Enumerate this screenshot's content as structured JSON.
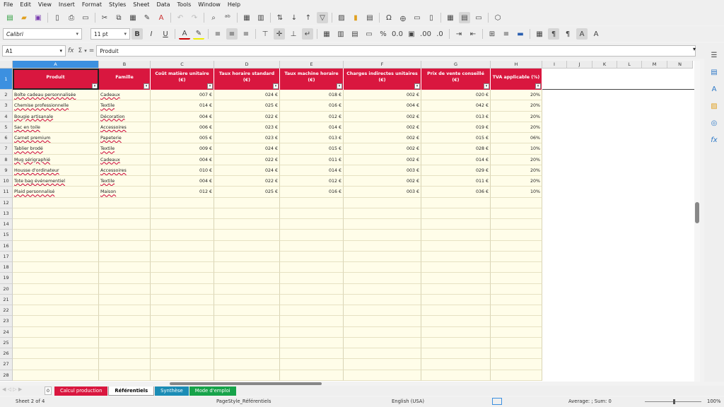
{
  "menu": [
    "File",
    "Edit",
    "View",
    "Insert",
    "Format",
    "Styles",
    "Sheet",
    "Data",
    "Tools",
    "Window",
    "Help"
  ],
  "toolbar": {
    "font_name": "Calibri",
    "font_size": "11 pt"
  },
  "formula_bar": {
    "cell_ref": "A1",
    "content": "Produit",
    "sum_symbol": "Σ",
    "equals": "="
  },
  "columns": [
    "A",
    "B",
    "C",
    "D",
    "E",
    "F",
    "G",
    "H",
    "I",
    "J",
    "K",
    "L",
    "M",
    "N"
  ],
  "header_row": [
    "Produit",
    "Famille",
    "Coût matière unitaire (€)",
    "Taux horaire standard (€)",
    "Taux machine horaire (€)",
    "Charges indirectes unitaires (€)",
    "Prix de vente conseillé (€)",
    "TVA applicable (%)"
  ],
  "rows": [
    [
      "Boîte cadeau personnalisée",
      "Cadeaux",
      "007 €",
      "024 €",
      "018 €",
      "002 €",
      "020 €",
      "20%"
    ],
    [
      "Chemise professionnelle",
      "Textile",
      "014 €",
      "025 €",
      "016 €",
      "004 €",
      "042 €",
      "20%"
    ],
    [
      "Bougie artisanale",
      "Décoration",
      "004 €",
      "022 €",
      "012 €",
      "002 €",
      "013 €",
      "20%"
    ],
    [
      "Sac en toile",
      "Accessoires",
      "006 €",
      "023 €",
      "014 €",
      "002 €",
      "019 €",
      "20%"
    ],
    [
      "Carnet premium",
      "Papeterie",
      "005 €",
      "023 €",
      "013 €",
      "002 €",
      "015 €",
      "06%"
    ],
    [
      "Tablier brodé",
      "Textile",
      "009 €",
      "024 €",
      "015 €",
      "002 €",
      "028 €",
      "10%"
    ],
    [
      "Mug sérigraphié",
      "Cadeaux",
      "004 €",
      "022 €",
      "011 €",
      "002 €",
      "014 €",
      "20%"
    ],
    [
      "Housse d'ordinateur",
      "Accessoires",
      "010 €",
      "024 €",
      "014 €",
      "003 €",
      "029 €",
      "20%"
    ],
    [
      "Tote bag événementiel",
      "Textile",
      "004 €",
      "022 €",
      "012 €",
      "002 €",
      "011 €",
      "20%"
    ],
    [
      "Plaid personnalisé",
      "Maison",
      "012 €",
      "025 €",
      "016 €",
      "003 €",
      "036 €",
      "10%"
    ]
  ],
  "row_numbers": [
    "1",
    "2",
    "3",
    "4",
    "5",
    "6",
    "7",
    "8",
    "9",
    "10",
    "11",
    "12",
    "13",
    "14",
    "15",
    "16",
    "17",
    "18",
    "19",
    "20",
    "21",
    "22",
    "23",
    "24",
    "25",
    "26",
    "27",
    "28"
  ],
  "tabs": [
    {
      "label": "Calcul production",
      "color": "#d9173f",
      "text": "#ffffff"
    },
    {
      "label": "Référentiels",
      "color": "#ffffff",
      "text": "#000000",
      "active": true
    },
    {
      "label": "Synthèse",
      "color": "#1b8cb5",
      "text": "#ffffff"
    },
    {
      "label": "Mode d'emploi",
      "color": "#17a34a",
      "text": "#ffffff"
    }
  ],
  "add_tab": "0",
  "status": {
    "sheet": "Sheet 2 of 4",
    "page_style": "PageStyle_Référentiels",
    "language": "English (USA)",
    "summary": "Average: ; Sum: 0",
    "zoom": "100%"
  },
  "colors": {
    "header_red": "#d9173f",
    "cell_cream": "#fffde9",
    "selection_blue": "#3c90e0"
  }
}
